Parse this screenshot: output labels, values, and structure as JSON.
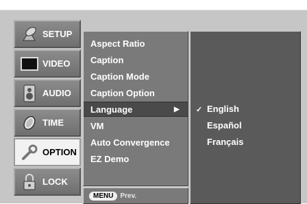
{
  "sidebar": {
    "items": [
      {
        "label": "SETUP",
        "icon": "satellite-dish-icon"
      },
      {
        "label": "VIDEO",
        "icon": "tv-screen-icon"
      },
      {
        "label": "AUDIO",
        "icon": "speaker-icon"
      },
      {
        "label": "TIME",
        "icon": "clock-icon"
      },
      {
        "label": "OPTION",
        "icon": "wrench-icon",
        "active": true
      },
      {
        "label": "LOCK",
        "icon": "padlock-icon"
      }
    ]
  },
  "menu": {
    "items": [
      {
        "label": "Aspect Ratio"
      },
      {
        "label": "Caption"
      },
      {
        "label": "Caption Mode"
      },
      {
        "label": "Caption Option"
      },
      {
        "label": "Language",
        "selected": true,
        "arrow": "▶"
      },
      {
        "label": "VM"
      },
      {
        "label": "Auto Convergence"
      },
      {
        "label": "EZ Demo"
      }
    ]
  },
  "prev_bar": {
    "key_label": "MENU",
    "text": "Prev."
  },
  "submenu": {
    "items": [
      {
        "label": "English",
        "check": "✓"
      },
      {
        "label": "Español",
        "check": ""
      },
      {
        "label": "Français",
        "check": ""
      }
    ]
  },
  "colors": {
    "background": "#c6c6c6",
    "menu_panel": "#7a7a7a",
    "selected_row": "#4a4a4a",
    "sub_panel": "#5a5a5a",
    "active_tab": "#f2f2f2"
  }
}
